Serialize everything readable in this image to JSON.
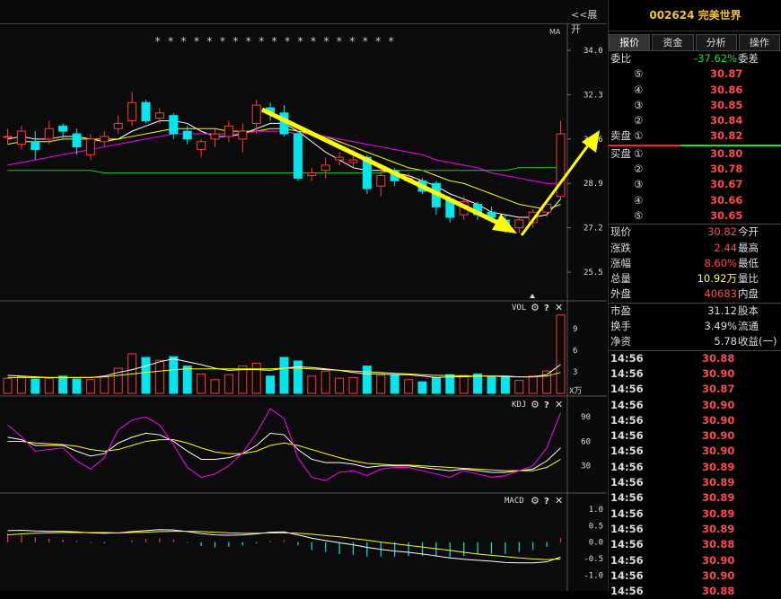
{
  "chart_data": {
    "type": "candlestick",
    "price_axis": {
      "ticks": [
        "34.0",
        "32.3",
        "30.6",
        "28.9",
        "27.2",
        "25.5"
      ],
      "ylim": [
        24.4,
        35.0
      ]
    },
    "ma_label": "MA",
    "star_marks": "* *  * *  *   * * * * *  *  * *  * * * * * *",
    "candles": [
      {
        "o": 30.7,
        "c": 30.7,
        "h": 31.0,
        "l": 30.4
      },
      {
        "o": 30.4,
        "c": 30.9,
        "h": 31.1,
        "l": 30.2
      },
      {
        "o": 30.5,
        "c": 30.2,
        "h": 30.9,
        "l": 29.8
      },
      {
        "o": 30.6,
        "c": 31.0,
        "h": 31.3,
        "l": 30.4
      },
      {
        "o": 31.1,
        "c": 30.9,
        "h": 31.2,
        "l": 30.6
      },
      {
        "o": 30.8,
        "c": 30.3,
        "h": 31.0,
        "l": 30.0
      },
      {
        "o": 30.0,
        "c": 30.6,
        "h": 30.8,
        "l": 29.8
      },
      {
        "o": 30.5,
        "c": 30.7,
        "h": 30.9,
        "l": 30.3
      },
      {
        "o": 31.0,
        "c": 31.2,
        "h": 31.5,
        "l": 30.8
      },
      {
        "o": 31.3,
        "c": 32.0,
        "h": 32.4,
        "l": 31.1
      },
      {
        "o": 32.0,
        "c": 31.3,
        "h": 32.1,
        "l": 31.2
      },
      {
        "o": 31.4,
        "c": 31.6,
        "h": 31.8,
        "l": 31.2
      },
      {
        "o": 31.5,
        "c": 30.8,
        "h": 31.6,
        "l": 30.6
      },
      {
        "o": 30.9,
        "c": 30.6,
        "h": 31.1,
        "l": 30.4
      },
      {
        "o": 30.2,
        "c": 30.5,
        "h": 30.6,
        "l": 29.9
      },
      {
        "o": 30.6,
        "c": 30.8,
        "h": 31.0,
        "l": 30.3
      },
      {
        "o": 30.7,
        "c": 31.1,
        "h": 31.3,
        "l": 30.5
      },
      {
        "o": 30.6,
        "c": 30.9,
        "h": 31.2,
        "l": 30.1
      },
      {
        "o": 31.2,
        "c": 31.9,
        "h": 32.1,
        "l": 30.8
      },
      {
        "o": 31.8,
        "c": 31.6,
        "h": 32.0,
        "l": 31.3
      },
      {
        "o": 31.6,
        "c": 30.8,
        "h": 31.9,
        "l": 30.7
      },
      {
        "o": 30.8,
        "c": 29.1,
        "h": 30.9,
        "l": 29.0
      },
      {
        "o": 29.2,
        "c": 29.3,
        "h": 29.5,
        "l": 29.0
      },
      {
        "o": 29.4,
        "c": 29.6,
        "h": 29.9,
        "l": 29.1
      },
      {
        "o": 29.8,
        "c": 29.9,
        "h": 30.1,
        "l": 29.6
      },
      {
        "o": 29.7,
        "c": 29.8,
        "h": 30.2,
        "l": 29.5
      },
      {
        "o": 29.9,
        "c": 28.7,
        "h": 30.0,
        "l": 28.5
      },
      {
        "o": 28.8,
        "c": 29.2,
        "h": 29.5,
        "l": 28.4
      },
      {
        "o": 29.4,
        "c": 29.0,
        "h": 29.5,
        "l": 28.8
      },
      {
        "o": 29.0,
        "c": 29.1,
        "h": 29.3,
        "l": 28.9
      },
      {
        "o": 29.0,
        "c": 28.6,
        "h": 29.1,
        "l": 28.5
      },
      {
        "o": 28.9,
        "c": 28.0,
        "h": 29.0,
        "l": 27.7
      },
      {
        "o": 28.3,
        "c": 27.6,
        "h": 28.4,
        "l": 27.4
      },
      {
        "o": 27.7,
        "c": 28.2,
        "h": 28.4,
        "l": 27.5
      },
      {
        "o": 28.1,
        "c": 27.7,
        "h": 28.2,
        "l": 27.5
      },
      {
        "o": 27.8,
        "c": 27.6,
        "h": 28.0,
        "l": 27.4
      },
      {
        "o": 27.5,
        "c": 27.2,
        "h": 27.7,
        "l": 27.0
      },
      {
        "o": 27.2,
        "c": 27.5,
        "h": 27.6,
        "l": 27.0
      },
      {
        "o": 27.4,
        "c": 27.8,
        "h": 27.9,
        "l": 27.2
      },
      {
        "o": 27.8,
        "c": 28.1,
        "h": 28.3,
        "l": 27.6
      },
      {
        "o": 28.4,
        "c": 30.8,
        "h": 31.3,
        "l": 28.3
      }
    ],
    "ma_lines": [
      {
        "name": "MA5",
        "color": "#ffffff",
        "values": [
          30.6,
          30.7,
          30.6,
          30.6,
          30.7,
          30.7,
          30.6,
          30.5,
          30.6,
          30.9,
          31.1,
          31.3,
          31.3,
          31.2,
          30.9,
          30.7,
          30.7,
          30.8,
          31.0,
          31.2,
          31.2,
          30.9,
          30.5,
          30.1,
          29.8,
          29.5,
          29.4,
          29.4,
          29.3,
          29.2,
          29.0,
          28.8,
          28.5,
          28.3,
          28.1,
          27.8,
          27.7,
          27.6,
          27.6,
          27.7,
          28.3
        ]
      },
      {
        "name": "MA10",
        "color": "#ffff00",
        "values": [
          30.4,
          30.5,
          30.5,
          30.5,
          30.6,
          30.6,
          30.6,
          30.6,
          30.6,
          30.7,
          30.8,
          30.9,
          31.0,
          31.0,
          31.0,
          31.0,
          30.9,
          30.9,
          30.9,
          31.0,
          31.0,
          30.9,
          30.8,
          30.7,
          30.5,
          30.3,
          30.1,
          29.9,
          29.7,
          29.5,
          29.4,
          29.2,
          29.0,
          28.9,
          28.7,
          28.5,
          28.3,
          28.1,
          28.0,
          27.9,
          28.1
        ]
      },
      {
        "name": "MA20",
        "color": "#ff00ff",
        "values": [
          29.6,
          29.7,
          29.8,
          29.9,
          30.0,
          30.1,
          30.2,
          30.3,
          30.4,
          30.5,
          30.6,
          30.7,
          30.8,
          30.8,
          30.8,
          30.8,
          30.8,
          30.8,
          30.9,
          30.9,
          30.9,
          30.8,
          30.8,
          30.7,
          30.6,
          30.5,
          30.4,
          30.3,
          30.2,
          30.1,
          30.0,
          29.8,
          29.7,
          29.6,
          29.5,
          29.3,
          29.2,
          29.1,
          29.0,
          28.9,
          28.9
        ]
      },
      {
        "name": "MA60",
        "color": "#22cc22",
        "values": [
          29.4,
          29.4,
          29.4,
          29.4,
          29.4,
          29.4,
          29.4,
          29.3,
          29.3,
          29.3,
          29.3,
          29.3,
          29.3,
          29.3,
          29.3,
          29.3,
          29.3,
          29.3,
          29.3,
          29.3,
          29.3,
          29.3,
          29.3,
          29.3,
          29.3,
          29.3,
          29.3,
          29.3,
          29.4,
          29.4,
          29.4,
          29.4,
          29.4,
          29.4,
          29.4,
          29.4,
          29.4,
          29.5,
          29.5,
          29.5,
          29.5
        ]
      }
    ],
    "vol": {
      "label": "VOL",
      "unit": "X万",
      "ticks": [
        "9",
        "6",
        "3"
      ],
      "ylim": [
        0,
        12
      ],
      "values": [
        2.1,
        2.3,
        2.0,
        2.1,
        2.4,
        2.0,
        1.9,
        2.3,
        3.5,
        5.5,
        5.0,
        4.6,
        5.1,
        3.8,
        2.7,
        1.9,
        2.6,
        3.8,
        4.2,
        2.4,
        5.0,
        4.5,
        2.4,
        3.1,
        2.1,
        2.2,
        3.8,
        2.5,
        2.6,
        1.9,
        1.6,
        2.2,
        2.6,
        2.5,
        2.7,
        2.3,
        2.2,
        1.8,
        2.4,
        3.1,
        10.9
      ],
      "ma1": [
        2.5,
        2.4,
        2.3,
        2.2,
        2.2,
        2.2,
        2.2,
        2.4,
        2.9,
        3.3,
        3.8,
        4.4,
        4.8,
        4.4,
        4.0,
        3.5,
        3.2,
        3.3,
        3.3,
        3.2,
        3.5,
        3.7,
        3.6,
        3.4,
        3.2,
        2.9,
        2.7,
        2.7,
        2.6,
        2.6,
        2.4,
        2.2,
        2.3,
        2.3,
        2.4,
        2.4,
        2.4,
        2.3,
        2.3,
        2.6,
        4.0
      ],
      "ma2": [
        2.2,
        2.2,
        2.2,
        2.2,
        2.2,
        2.2,
        2.2,
        2.3,
        2.5,
        2.7,
        2.9,
        3.1,
        3.3,
        3.4,
        3.4,
        3.4,
        3.4,
        3.4,
        3.4,
        3.4,
        3.5,
        3.5,
        3.4,
        3.3,
        3.2,
        3.1,
        3.0,
        2.9,
        2.8,
        2.7,
        2.6,
        2.5,
        2.5,
        2.4,
        2.4,
        2.4,
        2.3,
        2.3,
        2.3,
        2.4,
        2.9
      ]
    },
    "kdj": {
      "label": "KDJ",
      "ticks": [
        "90",
        "60",
        "30"
      ],
      "ylim": [
        0,
        110
      ],
      "k": [
        65,
        62,
        55,
        55,
        55,
        48,
        42,
        45,
        58,
        65,
        70,
        68,
        60,
        48,
        38,
        38,
        40,
        45,
        55,
        70,
        68,
        50,
        38,
        34,
        34,
        32,
        28,
        30,
        30,
        30,
        28,
        26,
        24,
        26,
        24,
        22,
        22,
        24,
        26,
        36,
        52
      ],
      "d": [
        60,
        60,
        58,
        57,
        56,
        54,
        50,
        48,
        50,
        55,
        60,
        62,
        62,
        58,
        52,
        47,
        45,
        45,
        48,
        55,
        58,
        55,
        50,
        45,
        40,
        36,
        33,
        32,
        31,
        31,
        30,
        29,
        28,
        27,
        26,
        25,
        24,
        24,
        24,
        28,
        38
      ],
      "j": [
        80,
        66,
        48,
        50,
        52,
        36,
        26,
        40,
        74,
        86,
        90,
        80,
        56,
        28,
        16,
        20,
        30,
        46,
        70,
        100,
        88,
        40,
        16,
        12,
        22,
        24,
        18,
        26,
        28,
        28,
        24,
        20,
        16,
        24,
        20,
        16,
        18,
        24,
        30,
        52,
        95
      ]
    },
    "macd": {
      "label": "MACD",
      "ticks": [
        "1.0",
        "0.5",
        "0.0",
        "-0.5",
        "-1.0"
      ],
      "ylim": [
        -1.4,
        1.3
      ],
      "dif": [
        0.35,
        0.36,
        0.34,
        0.33,
        0.33,
        0.31,
        0.28,
        0.27,
        0.28,
        0.32,
        0.35,
        0.38,
        0.37,
        0.32,
        0.26,
        0.22,
        0.21,
        0.22,
        0.25,
        0.3,
        0.31,
        0.22,
        0.12,
        0.05,
        -0.02,
        -0.08,
        -0.16,
        -0.22,
        -0.27,
        -0.31,
        -0.36,
        -0.42,
        -0.48,
        -0.52,
        -0.55,
        -0.58,
        -0.62,
        -0.63,
        -0.63,
        -0.6,
        -0.45
      ],
      "dea": [
        0.22,
        0.25,
        0.27,
        0.28,
        0.29,
        0.29,
        0.29,
        0.29,
        0.28,
        0.29,
        0.3,
        0.32,
        0.33,
        0.33,
        0.32,
        0.3,
        0.28,
        0.27,
        0.27,
        0.28,
        0.28,
        0.27,
        0.24,
        0.2,
        0.16,
        0.11,
        0.06,
        0.0,
        -0.05,
        -0.1,
        -0.15,
        -0.2,
        -0.25,
        -0.31,
        -0.36,
        -0.4,
        -0.44,
        -0.48,
        -0.51,
        -0.53,
        -0.51
      ],
      "bar": [
        0.26,
        0.22,
        0.14,
        0.1,
        0.08,
        0.04,
        -0.02,
        -0.04,
        0.0,
        0.06,
        0.1,
        0.12,
        0.08,
        -0.02,
        -0.12,
        -0.16,
        -0.14,
        -0.1,
        -0.04,
        0.04,
        0.06,
        -0.1,
        -0.24,
        -0.3,
        -0.36,
        -0.38,
        -0.44,
        -0.44,
        -0.44,
        -0.42,
        -0.42,
        -0.44,
        -0.46,
        -0.42,
        -0.38,
        -0.36,
        -0.36,
        -0.3,
        -0.24,
        -0.14,
        0.12
      ]
    }
  },
  "toolbar": {
    "expand_label": "<<展开",
    "icons": [
      "gear-icon",
      "help-icon",
      "close-icon"
    ]
  },
  "stock": {
    "code": "002624",
    "name": "完美世界"
  },
  "tabs": [
    "报价",
    "资金",
    "分析",
    "操作"
  ],
  "weibi": {
    "label": "委比",
    "value": "-37.62%",
    "right": "委差"
  },
  "sell_label": "卖盘",
  "buy_label": "买盘",
  "sells": [
    {
      "idx": "⑤",
      "price": "30.87"
    },
    {
      "idx": "④",
      "price": "30.86"
    },
    {
      "idx": "③",
      "price": "30.85"
    },
    {
      "idx": "②",
      "price": "30.84"
    },
    {
      "idx": "①",
      "price": "30.82"
    }
  ],
  "buys": [
    {
      "idx": "①",
      "price": "30.80"
    },
    {
      "idx": "②",
      "price": "30.78"
    },
    {
      "idx": "③",
      "price": "30.67"
    },
    {
      "idx": "④",
      "price": "30.66"
    },
    {
      "idx": "⑤",
      "price": "30.65"
    }
  ],
  "quote": [
    {
      "l": "现价",
      "v": "30.82",
      "r": "今开",
      "c": "red"
    },
    {
      "l": "涨跌",
      "v": "2.44",
      "r": "最高",
      "c": "red"
    },
    {
      "l": "涨幅",
      "v": "8.60%",
      "r": "最低",
      "c": "red"
    },
    {
      "l": "总量",
      "v": "10.92万",
      "r": "量比",
      "c": "yel"
    },
    {
      "l": "外盘",
      "v": "40683",
      "r": "内盘",
      "c": "red"
    }
  ],
  "fund": [
    {
      "l": "市盈",
      "v": "31.12",
      "r": "股本"
    },
    {
      "l": "换手",
      "v": "3.49%",
      "r": "流通"
    },
    {
      "l": "净资",
      "v": "5.78",
      "r": "收益(一)"
    }
  ],
  "ticks": [
    {
      "t": "14:56",
      "p": "30.88"
    },
    {
      "t": "14:56",
      "p": "30.90"
    },
    {
      "t": "14:56",
      "p": "30.87"
    },
    {
      "t": "14:56",
      "p": "30.90"
    },
    {
      "t": "14:56",
      "p": "30.90"
    },
    {
      "t": "14:56",
      "p": "30.90"
    },
    {
      "t": "14:56",
      "p": "30.90"
    },
    {
      "t": "14:56",
      "p": "30.89"
    },
    {
      "t": "14:56",
      "p": "30.89"
    },
    {
      "t": "14:56",
      "p": "30.89"
    },
    {
      "t": "14:56",
      "p": "30.89"
    },
    {
      "t": "14:56",
      "p": "30.89"
    },
    {
      "t": "14:56",
      "p": "30.88"
    },
    {
      "t": "14:56",
      "p": "30.90"
    },
    {
      "t": "14:56",
      "p": "30.90"
    },
    {
      "t": "14:56",
      "p": "30.88"
    }
  ],
  "colors": {
    "up": "#ff3b3b",
    "down": "#00e5ee",
    "sell_line": "#ff2222",
    "buy_line": "#22dd22"
  }
}
